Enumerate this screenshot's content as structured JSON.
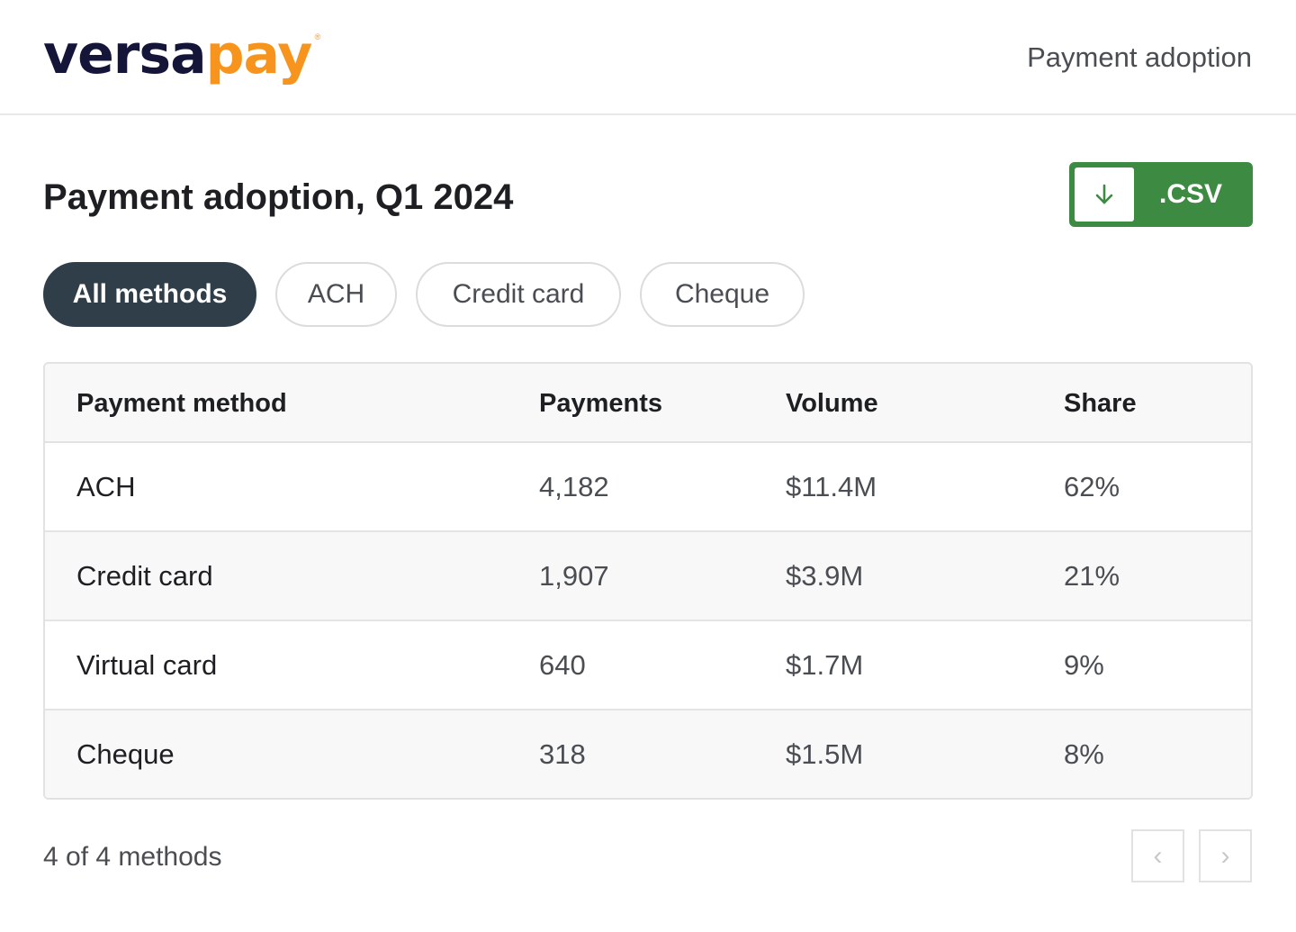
{
  "brand": {
    "logo_part1": "versa",
    "logo_part2": "pay",
    "registered_mark": "®",
    "colors": {
      "navy": "#15153a",
      "orange": "#f7941d"
    }
  },
  "header": {
    "title": "Payment adoption"
  },
  "page": {
    "title": "Payment adoption, Q1 2024"
  },
  "export": {
    "label": ".CSV",
    "icon": "download-arrow-icon",
    "color": "#3d8a42"
  },
  "filters": [
    {
      "label": "All methods",
      "active": true
    },
    {
      "label": "ACH",
      "active": false
    },
    {
      "label": "Credit card",
      "active": false
    },
    {
      "label": "Cheque",
      "active": false
    }
  ],
  "table": {
    "columns": [
      "Payment method",
      "Payments",
      "Volume",
      "Share"
    ],
    "rows": [
      {
        "method": "ACH",
        "payments": "4,182",
        "volume": "$11.4M",
        "share": "62%"
      },
      {
        "method": "Credit card",
        "payments": "1,907",
        "volume": "$3.9M",
        "share": "21%"
      },
      {
        "method": "Virtual card",
        "payments": "640",
        "volume": "$1.7M",
        "share": "9%"
      },
      {
        "method": "Cheque",
        "payments": "318",
        "volume": "$1.5M",
        "share": "8%"
      }
    ]
  },
  "footer": {
    "count_text": "4 of 4 methods",
    "prev_icon": "chevron-left-icon",
    "next_icon": "chevron-right-icon",
    "prev_glyph": "‹",
    "next_glyph": "›"
  }
}
